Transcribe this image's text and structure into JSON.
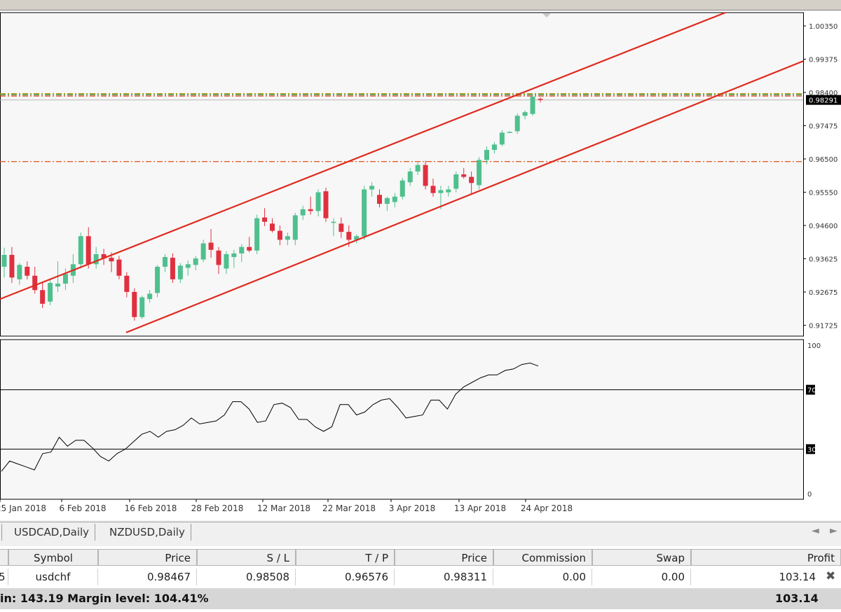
{
  "chart_data": {
    "type": "candlestick",
    "symbol": "USDCHF",
    "timeframe": "Daily",
    "current_price": "0.98291",
    "price_labels": [
      "1.00350",
      "0.99375",
      "0.98400",
      "0.97475",
      "0.96500",
      "0.95550",
      "0.94600",
      "0.93625",
      "0.92675",
      "0.91725"
    ],
    "x_labels": [
      "25 Jan 2018",
      "6 Feb 2018",
      "16 Feb 2018",
      "28 Feb 2018",
      "12 Mar 2018",
      "22 Mar 2018",
      "3 Apr 2018",
      "13 Apr 2018",
      "24 Apr 2018"
    ],
    "ylim": [
      0.9172,
      1.0072
    ],
    "candles": [
      {
        "o": 0.9365,
        "h": 0.9418,
        "l": 0.9335,
        "c": 0.9398
      },
      {
        "o": 0.9398,
        "h": 0.942,
        "l": 0.932,
        "c": 0.9335
      },
      {
        "o": 0.933,
        "h": 0.9375,
        "l": 0.9315,
        "c": 0.937
      },
      {
        "o": 0.9365,
        "h": 0.938,
        "l": 0.933,
        "c": 0.934
      },
      {
        "o": 0.934,
        "h": 0.9365,
        "l": 0.929,
        "c": 0.93
      },
      {
        "o": 0.93,
        "h": 0.932,
        "l": 0.925,
        "c": 0.9262
      },
      {
        "o": 0.9268,
        "h": 0.933,
        "l": 0.9258,
        "c": 0.932
      },
      {
        "o": 0.931,
        "h": 0.938,
        "l": 0.9295,
        "c": 0.9318
      },
      {
        "o": 0.9318,
        "h": 0.936,
        "l": 0.93,
        "c": 0.9345
      },
      {
        "o": 0.934,
        "h": 0.94,
        "l": 0.932,
        "c": 0.9372
      },
      {
        "o": 0.9372,
        "h": 0.946,
        "l": 0.936,
        "c": 0.945
      },
      {
        "o": 0.945,
        "h": 0.9475,
        "l": 0.936,
        "c": 0.9372
      },
      {
        "o": 0.9372,
        "h": 0.942,
        "l": 0.936,
        "c": 0.94
      },
      {
        "o": 0.94,
        "h": 0.9415,
        "l": 0.937,
        "c": 0.9388
      },
      {
        "o": 0.939,
        "h": 0.9405,
        "l": 0.935,
        "c": 0.938
      },
      {
        "o": 0.9385,
        "h": 0.9395,
        "l": 0.933,
        "c": 0.934
      },
      {
        "o": 0.934,
        "h": 0.935,
        "l": 0.928,
        "c": 0.9295
      },
      {
        "o": 0.9295,
        "h": 0.9305,
        "l": 0.9215,
        "c": 0.9225
      },
      {
        "o": 0.9225,
        "h": 0.9285,
        "l": 0.922,
        "c": 0.928
      },
      {
        "o": 0.9275,
        "h": 0.93,
        "l": 0.9265,
        "c": 0.929
      },
      {
        "o": 0.9292,
        "h": 0.937,
        "l": 0.928,
        "c": 0.9365
      },
      {
        "o": 0.9365,
        "h": 0.94,
        "l": 0.935,
        "c": 0.9392
      },
      {
        "o": 0.939,
        "h": 0.9402,
        "l": 0.932,
        "c": 0.933
      },
      {
        "o": 0.933,
        "h": 0.9375,
        "l": 0.932,
        "c": 0.9368
      },
      {
        "o": 0.9362,
        "h": 0.9382,
        "l": 0.934,
        "c": 0.9372
      },
      {
        "o": 0.937,
        "h": 0.9395,
        "l": 0.9355,
        "c": 0.9388
      },
      {
        "o": 0.9385,
        "h": 0.944,
        "l": 0.9378,
        "c": 0.943
      },
      {
        "o": 0.9432,
        "h": 0.947,
        "l": 0.939,
        "c": 0.9412
      },
      {
        "o": 0.941,
        "h": 0.942,
        "l": 0.9345,
        "c": 0.937
      },
      {
        "o": 0.936,
        "h": 0.9408,
        "l": 0.9345,
        "c": 0.94
      },
      {
        "o": 0.9392,
        "h": 0.9412,
        "l": 0.9362,
        "c": 0.9402
      },
      {
        "o": 0.9402,
        "h": 0.9428,
        "l": 0.9378,
        "c": 0.942
      },
      {
        "o": 0.942,
        "h": 0.9448,
        "l": 0.9405,
        "c": 0.941
      },
      {
        "o": 0.941,
        "h": 0.951,
        "l": 0.94,
        "c": 0.95
      },
      {
        "o": 0.9502,
        "h": 0.9528,
        "l": 0.9478,
        "c": 0.949
      },
      {
        "o": 0.9485,
        "h": 0.95,
        "l": 0.946,
        "c": 0.9465
      },
      {
        "o": 0.9465,
        "h": 0.948,
        "l": 0.9425,
        "c": 0.944
      },
      {
        "o": 0.944,
        "h": 0.946,
        "l": 0.9425,
        "c": 0.945
      },
      {
        "o": 0.944,
        "h": 0.9515,
        "l": 0.9425,
        "c": 0.9508
      },
      {
        "o": 0.9508,
        "h": 0.9535,
        "l": 0.9495,
        "c": 0.9525
      },
      {
        "o": 0.9525,
        "h": 0.956,
        "l": 0.951,
        "c": 0.952
      },
      {
        "o": 0.952,
        "h": 0.958,
        "l": 0.9505,
        "c": 0.9572
      },
      {
        "o": 0.9575,
        "h": 0.9585,
        "l": 0.949,
        "c": 0.95
      },
      {
        "o": 0.949,
        "h": 0.95,
        "l": 0.945,
        "c": 0.949
      },
      {
        "o": 0.9485,
        "h": 0.9502,
        "l": 0.9445,
        "c": 0.9462
      },
      {
        "o": 0.9462,
        "h": 0.948,
        "l": 0.942,
        "c": 0.944
      },
      {
        "o": 0.944,
        "h": 0.9455,
        "l": 0.943,
        "c": 0.945
      },
      {
        "o": 0.945,
        "h": 0.959,
        "l": 0.944,
        "c": 0.958
      },
      {
        "o": 0.958,
        "h": 0.96,
        "l": 0.956,
        "c": 0.959
      },
      {
        "o": 0.9565,
        "h": 0.958,
        "l": 0.953,
        "c": 0.954
      },
      {
        "o": 0.954,
        "h": 0.956,
        "l": 0.952,
        "c": 0.9556
      },
      {
        "o": 0.9545,
        "h": 0.957,
        "l": 0.953,
        "c": 0.956
      },
      {
        "o": 0.956,
        "h": 0.9612,
        "l": 0.9552,
        "c": 0.9605
      },
      {
        "o": 0.96,
        "h": 0.964,
        "l": 0.959,
        "c": 0.963
      },
      {
        "o": 0.963,
        "h": 0.9655,
        "l": 0.962,
        "c": 0.9648
      },
      {
        "o": 0.9648,
        "h": 0.966,
        "l": 0.958,
        "c": 0.959
      },
      {
        "o": 0.959,
        "h": 0.961,
        "l": 0.956,
        "c": 0.957
      },
      {
        "o": 0.957,
        "h": 0.959,
        "l": 0.9525,
        "c": 0.9578
      },
      {
        "o": 0.9572,
        "h": 0.959,
        "l": 0.956,
        "c": 0.958
      },
      {
        "o": 0.9582,
        "h": 0.963,
        "l": 0.9572,
        "c": 0.9622
      },
      {
        "o": 0.9622,
        "h": 0.964,
        "l": 0.961,
        "c": 0.9615
      },
      {
        "o": 0.9615,
        "h": 0.963,
        "l": 0.9565,
        "c": 0.9598
      },
      {
        "o": 0.9592,
        "h": 0.967,
        "l": 0.958,
        "c": 0.9662
      },
      {
        "o": 0.9662,
        "h": 0.97,
        "l": 0.965,
        "c": 0.969
      },
      {
        "o": 0.969,
        "h": 0.9712,
        "l": 0.968,
        "c": 0.9705
      },
      {
        "o": 0.9705,
        "h": 0.9745,
        "l": 0.97,
        "c": 0.9738
      },
      {
        "o": 0.974,
        "h": 0.9742,
        "l": 0.9738,
        "c": 0.974
      },
      {
        "o": 0.9742,
        "h": 0.9792,
        "l": 0.9735,
        "c": 0.9785
      },
      {
        "o": 0.9785,
        "h": 0.98,
        "l": 0.9775,
        "c": 0.9795
      },
      {
        "o": 0.979,
        "h": 0.9845,
        "l": 0.9785,
        "c": 0.9838
      },
      {
        "o": 0.9832,
        "h": 0.9836,
        "l": 0.9822,
        "c": 0.9829
      }
    ],
    "channel_upper": [
      [
        0.93,
        0.926
      ],
      [
        1.007,
        0.995
      ]
    ],
    "channel_lower": [
      [
        0.93,
        0.918
      ],
      [
        1.007,
        0.987
      ]
    ],
    "hlines": [
      {
        "price": 0.98467,
        "color": "#b8a020"
      },
      {
        "price": 0.9844,
        "color": "#3a9a3a"
      },
      {
        "price": 0.984,
        "color": "#e04020"
      },
      {
        "price": 0.96576,
        "color": "#e06030"
      }
    ],
    "rsi": {
      "levels": [
        70,
        30
      ],
      "axis_labels": [
        "100",
        "70",
        "30",
        "0"
      ],
      "values": [
        15,
        22,
        20,
        18,
        16,
        27,
        28,
        38,
        32,
        36,
        36,
        31,
        25,
        22,
        27,
        30,
        35,
        40,
        42,
        38,
        42,
        43,
        46,
        51,
        47,
        48,
        49,
        53,
        62,
        62,
        57,
        48,
        49,
        60,
        61,
        58,
        50,
        50,
        45,
        42,
        45,
        60,
        60,
        53,
        55,
        60,
        63,
        64,
        58,
        51,
        52,
        53,
        63,
        63,
        57,
        67,
        72,
        75,
        78,
        80,
        80,
        83,
        84,
        87,
        88,
        86
      ]
    }
  },
  "tabs": [
    "USDCAD,Daily",
    "NZDUSD,Daily"
  ],
  "table": {
    "headers": [
      "Symbol",
      "Price",
      "S / L",
      "T / P",
      "Price",
      "Commission",
      "Swap",
      "Profit"
    ],
    "row": {
      "id_fragment": "5",
      "symbol": "usdchf",
      "open_price": "0.98467",
      "sl": "0.98508",
      "tp": "0.96576",
      "price": "0.98311",
      "commission": "0.00",
      "swap": "0.00",
      "profit": "103.14"
    },
    "summary": "in: 143.19  Margin level: 104.41%",
    "summary_total": "103.14"
  },
  "colors": {
    "bull": "#4fc08d",
    "bear": "#e0303f",
    "channel": "#e02a1e"
  }
}
